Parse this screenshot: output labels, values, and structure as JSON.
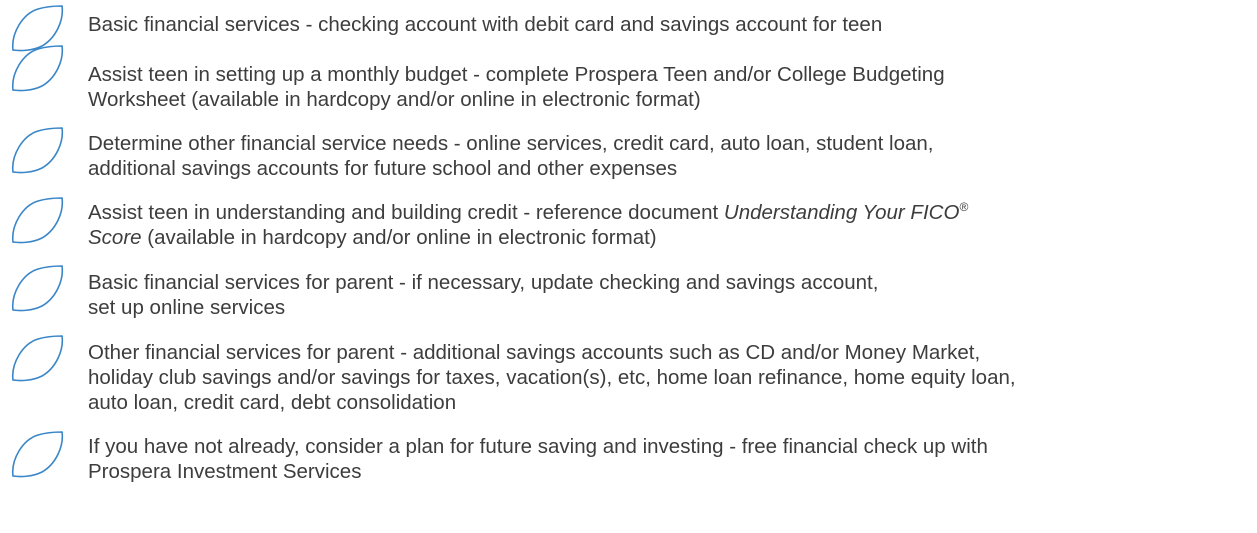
{
  "colors": {
    "leaf_stroke": "#3a86c8",
    "text": "#3d3d3d"
  },
  "icon": "leaf-outline-icon",
  "items": [
    {
      "lines": [
        "Basic financial services - checking account with debit card and savings account for teen"
      ]
    },
    {
      "lines": [
        "Assist teen in setting up a monthly budget - complete Prospera Teen and/or College Budgeting",
        "Worksheet (available in hardcopy and/or online in electronic format)"
      ]
    },
    {
      "lines": [
        "Determine other financial service needs - online services, credit card, auto loan, student loan,",
        "additional savings accounts for future school and other expenses"
      ]
    },
    {
      "line1_prefix": "Assist teen in understanding and building credit - reference document ",
      "line1_italic": "Understanding Your FICO",
      "registered_mark": "®",
      "line2_italic": "Score",
      "line2_rest": " (available in hardcopy and/or online in electronic format)"
    },
    {
      "lines": [
        "Basic financial services for parent - if necessary, update checking and savings account,",
        "set up online services"
      ]
    },
    {
      "lines": [
        "Other financial services for parent - additional savings accounts such as CD and/or Money Market,",
        "holiday club savings and/or savings for taxes, vacation(s), etc, home loan refinance, home equity loan,",
        "auto loan, credit card, debt consolidation"
      ]
    },
    {
      "lines": [
        "If you have not already, consider a plan for future saving and investing - free financial check up with",
        "Prospera Investment Services"
      ]
    }
  ]
}
